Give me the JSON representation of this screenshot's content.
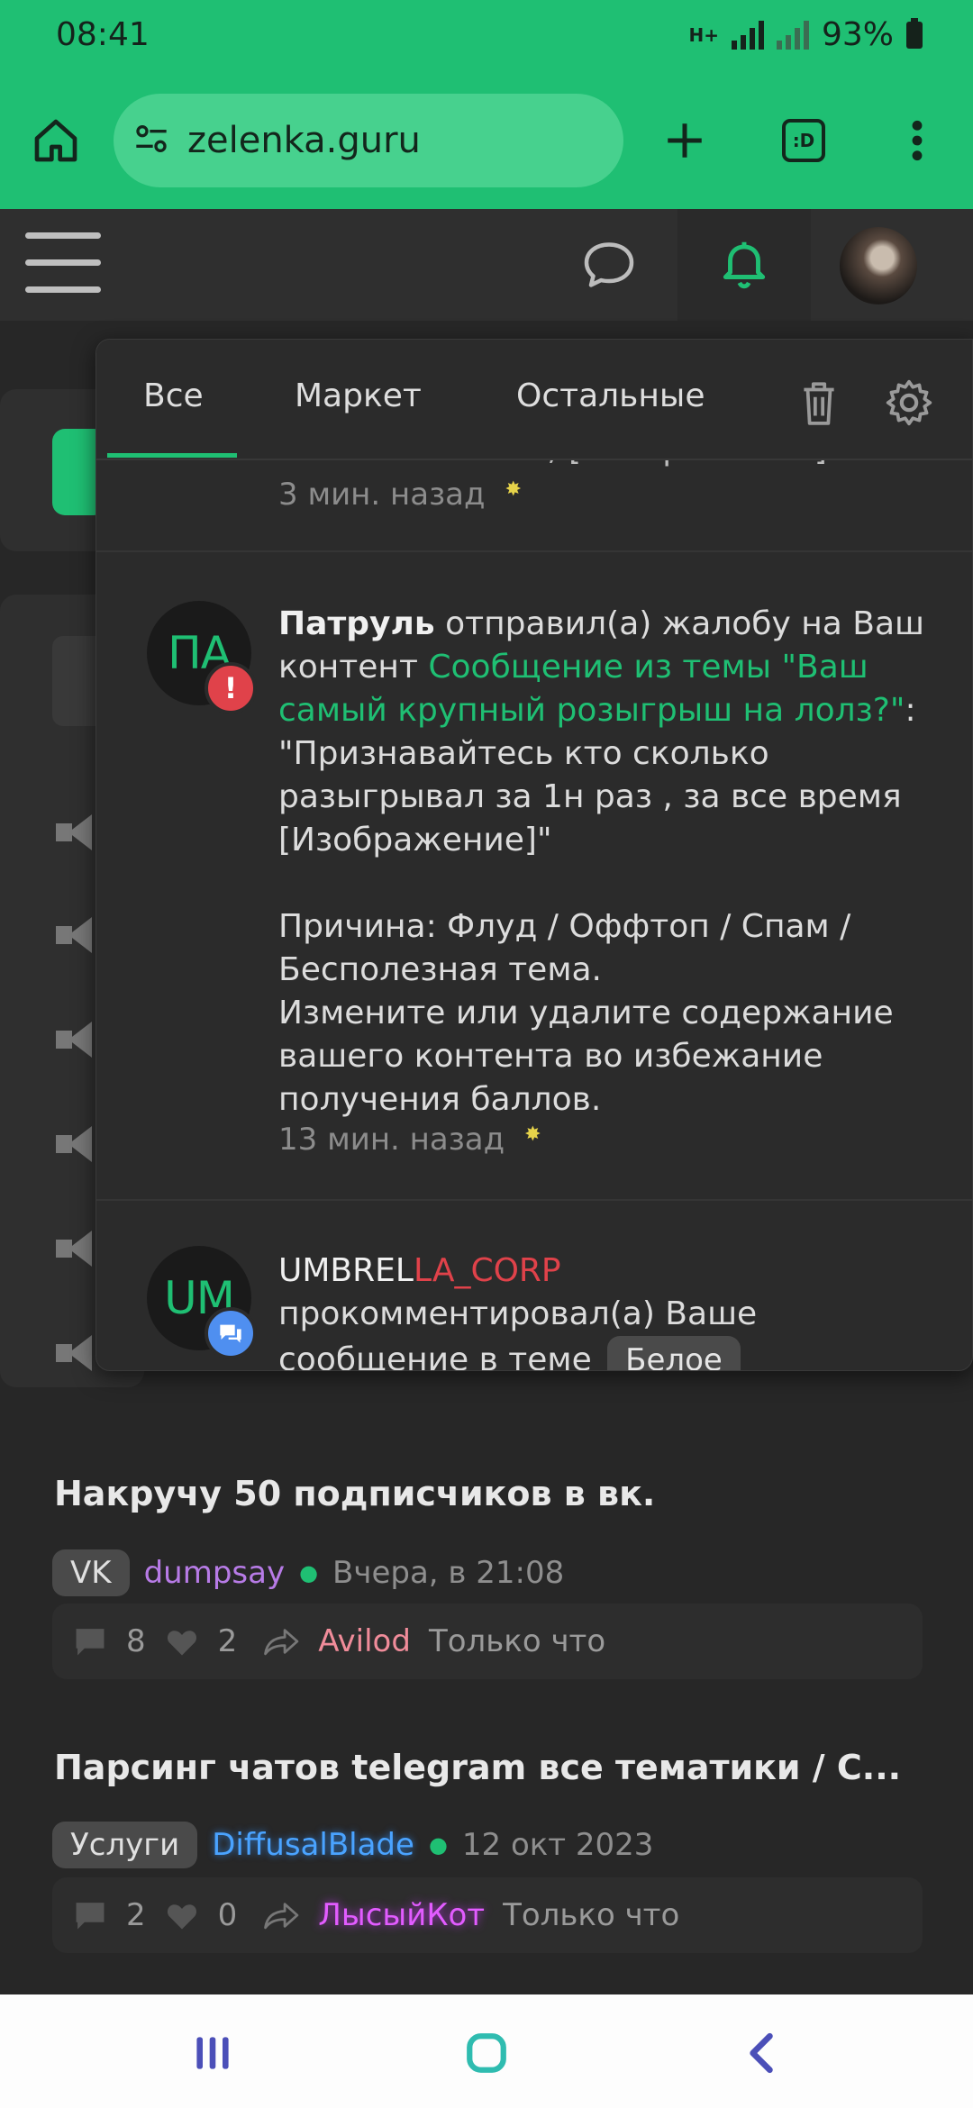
{
  "status_bar": {
    "time": "08:41",
    "network": "H+",
    "battery": "93%"
  },
  "browser": {
    "url": "zelenka.guru",
    "tab_badge": ":D"
  },
  "popup": {
    "tabs": [
      "Все",
      "Маркет",
      "Остальные"
    ],
    "active_tab": "Все",
    "notifications": [
      {
        "cut_text": "Семья Пашевое; [Изображение]",
        "time": "3 мин. назад"
      },
      {
        "avatar_initials": "ПА",
        "actor": "Патруль",
        "action": " отправил(а) жалобу на Ваш контент ",
        "link": "Сообщение из темы \"Ваш самый крупный розыгрыш на лолз?\"",
        "quote": ": \"Признавайтесь кто сколько разыгрывал за 1н раз , за все время [Изображение]\"",
        "reason": "Причина: Флуд / Оффтоп / Спам / Бесполезная тема.",
        "advice": "Измените или удалите содержание вашего контента во избежание получения баллов.",
        "time": "13 мин. назад"
      },
      {
        "avatar_initials": "UM",
        "actor_part1": "UMBREL",
        "actor_part2": "LA_CORP",
        "action": " прокомментировал(а) Ваше сообщение в теме ",
        "tag": "Белое"
      }
    ]
  },
  "threads": [
    {
      "title": "Накручу 50 подписчиков в вк.",
      "category": "VK",
      "author": "dumpsay",
      "date": "Вчера, в 21:08",
      "replies": "8",
      "likes": "2",
      "last_user": "Avilod",
      "last_time": "Только что"
    },
    {
      "title": "Парсинг чатов telegram все тематики / С...",
      "category": "Услуги",
      "author": "DiffusalBlade",
      "date": "12 окт 2023",
      "replies": "2",
      "likes": "0",
      "last_user": "ЛысыйКот",
      "last_time": "Только что"
    }
  ],
  "colors": {
    "brand_green": "#1fbf73",
    "alert_red": "#e0424a",
    "badge_blue": "#4f8ff0",
    "author_purple": "#b77be6",
    "author_blue": "#4aa3ff",
    "last_user_pink": "#f08c9a",
    "last_user_magenta": "#e25cff"
  },
  "icons": [
    "home-icon",
    "site-settings-icon",
    "plus-icon",
    "tabs-icon",
    "more-icon",
    "menu-icon",
    "chat-icon",
    "bell-icon",
    "trash-icon",
    "gear-icon",
    "alert-icon",
    "comment-badge-icon",
    "reply-icon",
    "heart-icon",
    "share-icon",
    "recents-icon",
    "home-nav-icon",
    "back-icon"
  ]
}
